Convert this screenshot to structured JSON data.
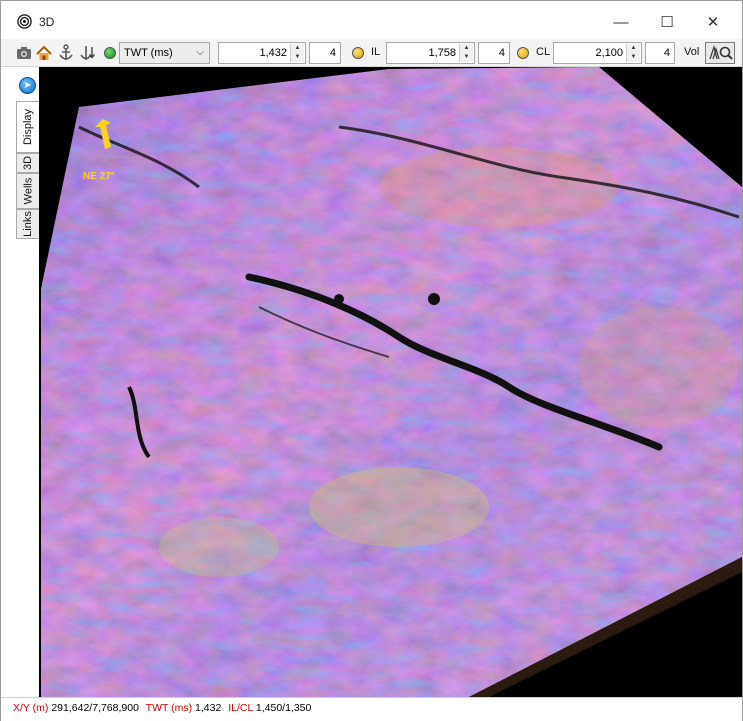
{
  "window": {
    "title": "3D",
    "controls": {
      "minimize": "—",
      "maximize": "☐",
      "close": "✕"
    }
  },
  "toolbar": {
    "icons": [
      "camera-icon",
      "home-icon",
      "anchor-icon",
      "anchor-down-icon"
    ],
    "domain_select": {
      "value": "TWT (ms)"
    },
    "twt_value": "1,432",
    "twt_step": "4",
    "il_label": "IL",
    "il_value": "1,758",
    "il_step": "4",
    "cl_label": "CL",
    "cl_value": "2,100",
    "cl_step": "4",
    "vol_label": "Vol",
    "colors": {
      "led_green": "#119a17",
      "led_yellow": "#f2b600"
    }
  },
  "sidebar": {
    "tabs": [
      {
        "label": "Display"
      },
      {
        "label": "3D"
      },
      {
        "label": "Wells"
      },
      {
        "label": "Links"
      }
    ]
  },
  "viewport": {
    "compass_label": "NE 27°",
    "colors": {
      "background": "#000000",
      "arrow": "#ffd21e"
    }
  },
  "status": {
    "xy_label": "X/Y (m)",
    "xy_value": "291,642/7,768,900",
    "twt_label": "TWT (ms)",
    "twt_value": "1,432",
    "ilcl_label": "IL/CL",
    "ilcl_value": "1,450/1,350"
  }
}
